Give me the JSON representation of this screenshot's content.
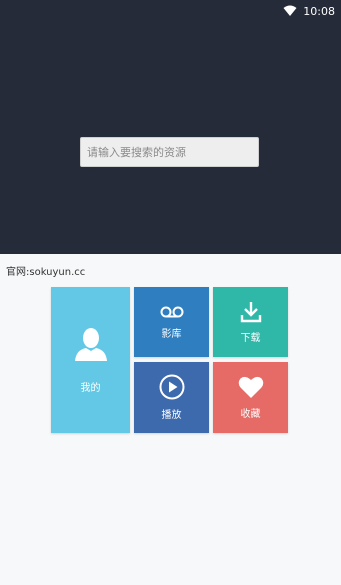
{
  "status_bar": {
    "time": "10:08",
    "wifi_icon": "wifi-icon"
  },
  "search": {
    "placeholder": "请输入要搜索的资源",
    "value": ""
  },
  "site_label": "官网:sokuyun.cc",
  "tiles": {
    "me": {
      "label": "我的",
      "icon": "person-icon",
      "color": "#62c8e6"
    },
    "library": {
      "label": "影库",
      "icon": "voicemail-icon",
      "color": "#2f7fc0"
    },
    "download": {
      "label": "下载",
      "icon": "download-icon",
      "color": "#2fb7a8"
    },
    "play": {
      "label": "播放",
      "icon": "play-circle-icon",
      "color": "#3d69ad"
    },
    "favorite": {
      "label": "收藏",
      "icon": "heart-icon",
      "color": "#e66a66"
    }
  },
  "colors": {
    "header_bg": "#252b39",
    "body_bg": "#f7f8f9"
  }
}
